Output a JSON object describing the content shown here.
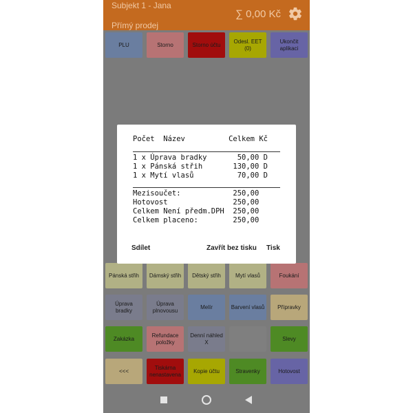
{
  "app": {
    "title": "Subjekt 1 - Jana",
    "subtitle": "Přímý prodej",
    "total": "∑ 0,00 Kč"
  },
  "top_buttons": [
    {
      "label": "PLU",
      "color": "#6a7ea0"
    },
    {
      "label": "Storno",
      "color": "#b77374"
    },
    {
      "label": "Storno účtu",
      "color": "#a10d0d"
    },
    {
      "label": "Odesl. EET (0)",
      "color": "#a7a702"
    },
    {
      "label": "Ukončit aplikaci",
      "color": "#6764a5"
    }
  ],
  "grid_buttons": [
    [
      {
        "label": "Pánská střih",
        "color": "#b1b185"
      },
      {
        "label": "Dámský střih",
        "color": "#b1b185"
      },
      {
        "label": "Dětský střih",
        "color": "#b1b185"
      },
      {
        "label": "Mytí vlasů",
        "color": "#b1b185"
      },
      {
        "label": "Foukání",
        "color": "#b77374"
      }
    ],
    [
      {
        "label": "Úprava bradky",
        "color": "#7a7c8c"
      },
      {
        "label": "Úprava plnovousu",
        "color": "#7a7c8c"
      },
      {
        "label": "Melír",
        "color": "#6a7ea0"
      },
      {
        "label": "Barvení vlasů",
        "color": "#6a7ea0"
      },
      {
        "label": "Přípravky",
        "color": "#b8a77a"
      }
    ],
    [
      {
        "label": "Zakázka",
        "color": "#4e8a24"
      },
      {
        "label": "Refundace položky",
        "color": "#b77374"
      },
      {
        "label": "Denní náhled X",
        "color": "#7a7c8c"
      },
      {
        "label": "",
        "color": "#7f7f7f"
      },
      {
        "label": "Slevy",
        "color": "#4e8a24"
      }
    ],
    [
      {
        "label": "<<<",
        "color": "#b8a77a"
      },
      {
        "label": "Tiskárna nenastavena",
        "color": "#a10d0d"
      },
      {
        "label": "Kopie účtu",
        "color": "#a7a702"
      },
      {
        "label": "Stravenky",
        "color": "#4e8a24"
      },
      {
        "label": "Hotovost",
        "color": "#6764a5"
      }
    ]
  ],
  "receipt": {
    "header": "Počet  Název          Celkem Kč",
    "items": [
      "1 x Úprava bradky       50,00 D",
      "1 x Pánská střih       130,00 D",
      "1 x Mytí vlasů          70,00 D"
    ],
    "totals": [
      "Mezisoučet:            250,00",
      "Hotovost               250,00",
      "Celkem Není předm.DPH  250,00",
      "Celkem placeno:        250,00"
    ]
  },
  "dialog_buttons": {
    "share": "Sdílet",
    "close_no_print": "Zavřít bez tisku",
    "print": "Tisk"
  },
  "icons": {
    "settings": "gear-icon",
    "nav_recent": "square-icon",
    "nav_home": "circle-icon",
    "nav_back": "triangle-icon"
  }
}
